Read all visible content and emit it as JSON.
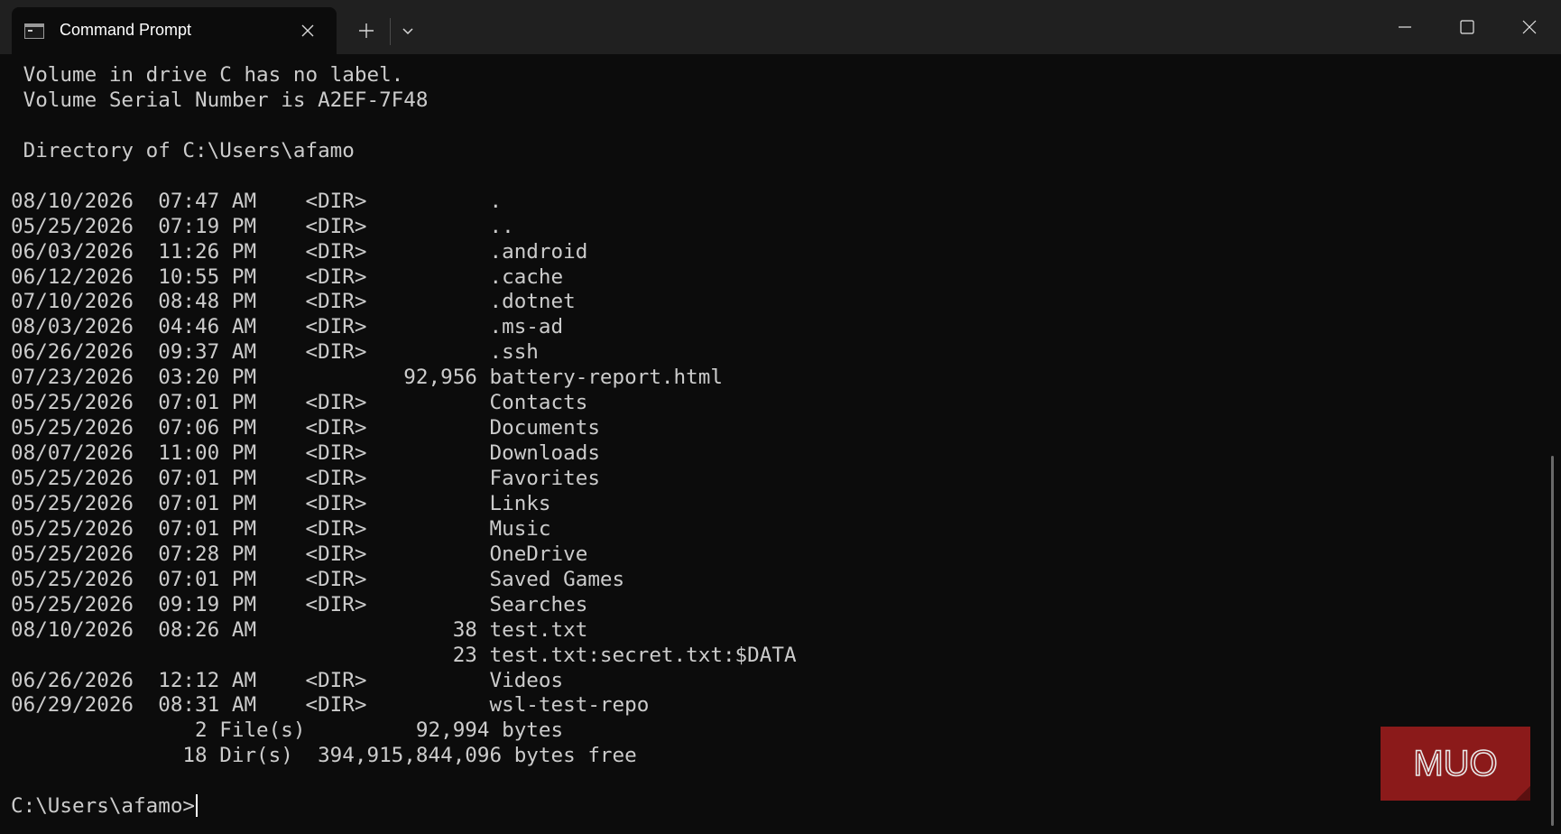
{
  "window": {
    "tab_title": "Command Prompt",
    "icons": {
      "tab": "terminal-icon",
      "close_tab": "close-icon",
      "new_tab": "plus-icon",
      "dropdown": "chevron-down-icon",
      "minimize": "minimize-icon",
      "maximize": "maximize-icon",
      "close_window": "close-icon"
    }
  },
  "terminal": {
    "lines": [
      " Volume in drive C has no label.",
      " Volume Serial Number is A2EF-7F48",
      "",
      " Directory of C:\\Users\\afamo",
      "",
      "08/10/2026  07:47 AM    <DIR>          .",
      "05/25/2026  07:19 PM    <DIR>          ..",
      "06/03/2026  11:26 PM    <DIR>          .android",
      "06/12/2026  10:55 PM    <DIR>          .cache",
      "07/10/2026  08:48 PM    <DIR>          .dotnet",
      "08/03/2026  04:46 AM    <DIR>          .ms-ad",
      "06/26/2026  09:37 AM    <DIR>          .ssh",
      "07/23/2026  03:20 PM            92,956 battery-report.html",
      "05/25/2026  07:01 PM    <DIR>          Contacts",
      "05/25/2026  07:06 PM    <DIR>          Documents",
      "08/07/2026  11:00 PM    <DIR>          Downloads",
      "05/25/2026  07:01 PM    <DIR>          Favorites",
      "05/25/2026  07:01 PM    <DIR>          Links",
      "05/25/2026  07:01 PM    <DIR>          Music",
      "05/25/2026  07:28 PM    <DIR>          OneDrive",
      "05/25/2026  07:01 PM    <DIR>          Saved Games",
      "05/25/2026  09:19 PM    <DIR>          Searches",
      "08/10/2026  08:26 AM                38 test.txt",
      "                                    23 test.txt:secret.txt:$DATA",
      "06/26/2026  12:12 AM    <DIR>          Videos",
      "06/29/2026  08:31 AM    <DIR>          wsl-test-repo",
      "               2 File(s)         92,994 bytes",
      "              18 Dir(s)  394,915,844,096 bytes free",
      ""
    ],
    "prompt": "C:\\Users\\afamo>",
    "foreground": "#cccccc",
    "background": "#0c0c0c"
  },
  "watermark": {
    "text": "MUO",
    "color": "#8b1a1a"
  }
}
